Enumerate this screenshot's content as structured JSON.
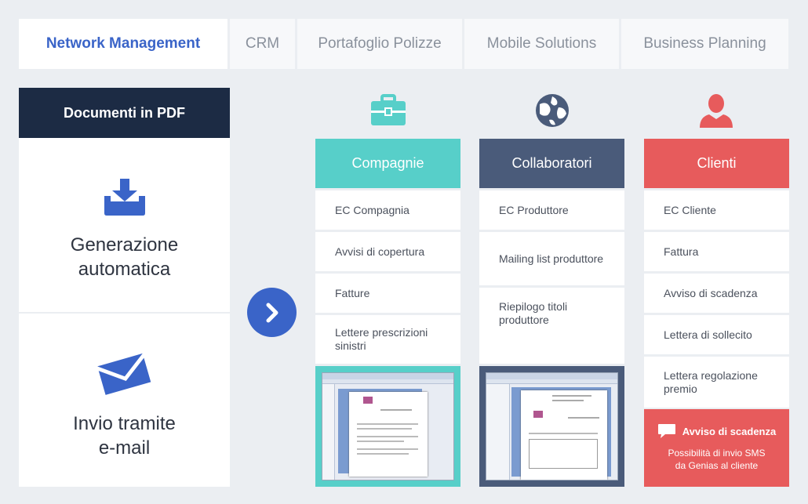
{
  "tabs": [
    "Network Management",
    "CRM",
    "Portafoglio Polizze",
    "Mobile Solutions",
    "Business Planning"
  ],
  "left": {
    "header": "Documenti in PDF",
    "card1": "Generazione\nautomatica",
    "card2": "Invio tramite\ne-mail"
  },
  "columns": {
    "compagnie": {
      "title": "Compagnie",
      "color": "#57cfc9",
      "items": [
        "EC Compagnia",
        "Avvisi di copertura",
        "Fatture",
        "Lettere prescrizioni sinistri"
      ]
    },
    "collaboratori": {
      "title": "Collaboratori",
      "color": "#4a5b7a",
      "items": [
        "EC Produttore",
        "Mailing list produttore",
        "Riepilogo titoli produttore"
      ]
    },
    "clienti": {
      "title": "Clienti",
      "color": "#e75b5c",
      "items": [
        "EC Cliente",
        "Fattura",
        "Avviso di scadenza",
        "Lettera di sollecito",
        "Lettera regolazione premio"
      ]
    }
  },
  "sms": {
    "title": "Avviso di scadenza",
    "text": "Possibilità di invio SMS\nda Genias al cliente"
  },
  "icons": {
    "download": "download-tray-icon",
    "mail": "envelope-icon",
    "arrow": "chevron-right-icon",
    "briefcase": "briefcase-icon",
    "globe": "globe-icon",
    "user": "user-icon",
    "chat": "chat-bubble-icon"
  }
}
